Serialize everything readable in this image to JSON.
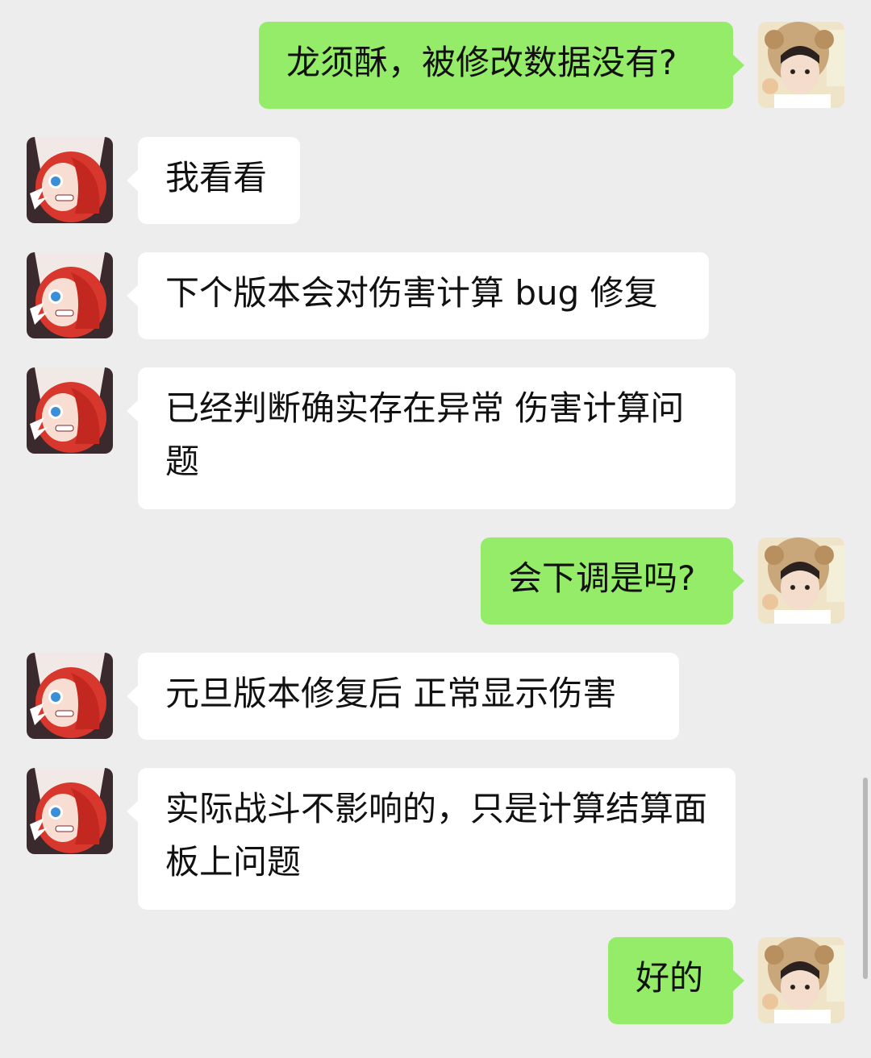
{
  "chat": {
    "messages": [
      {
        "sender": "me",
        "avatar": "user-avatar-icon",
        "text": "龙须酥，被修改数据没有?"
      },
      {
        "sender": "them",
        "avatar": "agent-avatar-icon",
        "text": "我看看"
      },
      {
        "sender": "them",
        "avatar": "agent-avatar-icon",
        "text": "下个版本会对伤害计算 bug 修复"
      },
      {
        "sender": "them",
        "avatar": "agent-avatar-icon",
        "text": "已经判断确实存在异常 伤害计算问题"
      },
      {
        "sender": "me",
        "avatar": "user-avatar-icon",
        "text": "会下调是吗?"
      },
      {
        "sender": "them",
        "avatar": "agent-avatar-icon",
        "text": "元旦版本修复后 正常显示伤害"
      },
      {
        "sender": "them",
        "avatar": "agent-avatar-icon",
        "text": "实际战斗不影响的，只是计算结算面板上问题"
      },
      {
        "sender": "me",
        "avatar": "user-avatar-icon",
        "text": "好的"
      }
    ]
  },
  "colors": {
    "background": "#ededed",
    "sent_bubble": "#95ec69",
    "received_bubble": "#ffffff",
    "text": "#111111"
  }
}
